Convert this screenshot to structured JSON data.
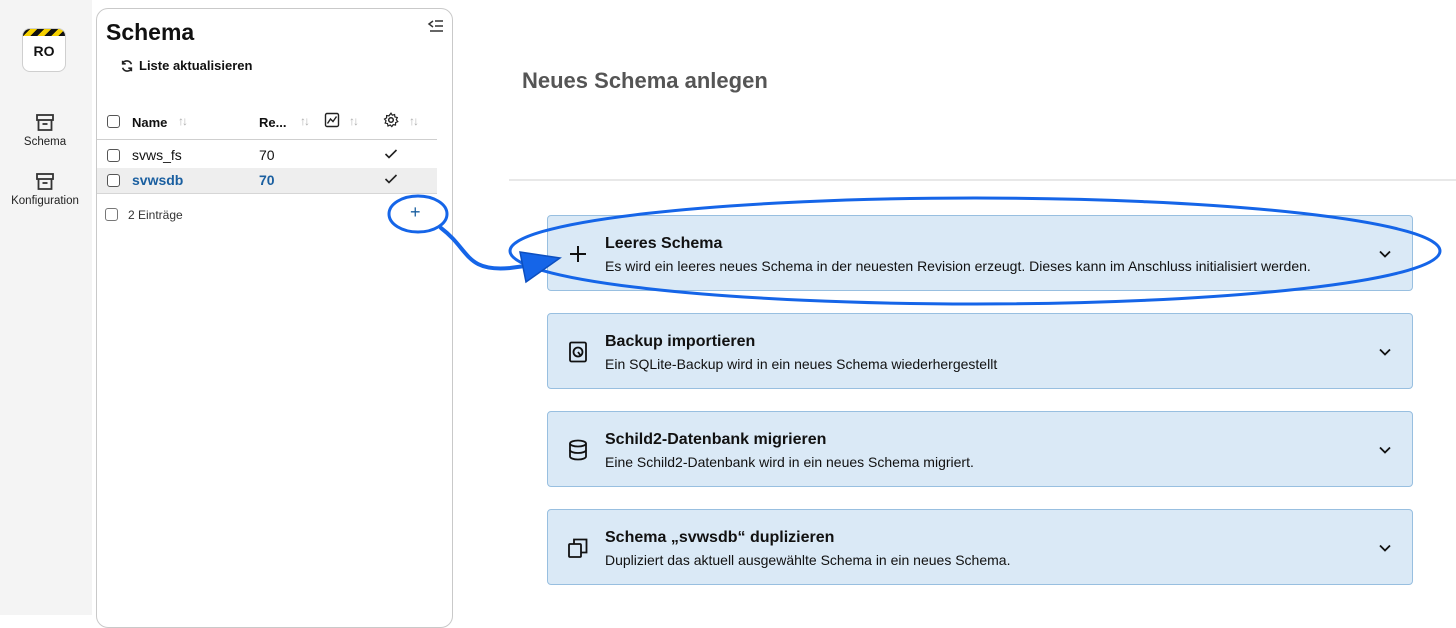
{
  "rail": {
    "badge": "RO",
    "items": [
      {
        "label": "Schema",
        "icon": "archive-icon"
      },
      {
        "label": "Konfiguration",
        "icon": "archive-icon"
      }
    ]
  },
  "panel": {
    "title": "Schema",
    "refresh_label": "Liste aktualisieren",
    "columns": {
      "name": "Name",
      "revision": "Re..."
    },
    "rows": [
      {
        "name": "svws_fs",
        "revision": "70",
        "selected": false
      },
      {
        "name": "svwsdb",
        "revision": "70",
        "selected": true
      }
    ],
    "count_label": "2 Einträge",
    "add_label": "+"
  },
  "main": {
    "title": "Neues Schema anlegen",
    "cards": [
      {
        "title": "Leeres Schema",
        "desc": "Es wird ein leeres neues Schema in der neuesten Revision erzeugt. Dieses kann im Anschluss initialisiert werden.",
        "icon": "plus-icon"
      },
      {
        "title": "Backup importieren",
        "desc": "Ein SQLite-Backup wird in ein neues Schema wiederhergestellt",
        "icon": "backup-file-icon"
      },
      {
        "title": "Schild2-Datenbank migrieren",
        "desc": "Eine Schild2-Datenbank wird in ein neues Schema migriert.",
        "icon": "database-icon"
      },
      {
        "title": "Schema „svwsdb“ duplizieren",
        "desc": "Dupliziert das aktuell ausgewählte Schema in ein neues Schema.",
        "icon": "copy-icon"
      }
    ]
  },
  "colors": {
    "accent": "#1a5fa0",
    "card_bg": "#dae9f6",
    "card_border": "#98bfe0",
    "annotation": "#1565e8"
  }
}
